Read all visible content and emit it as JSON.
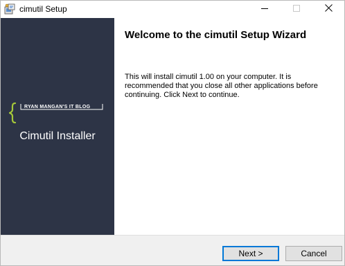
{
  "window": {
    "title": "cimutil Setup",
    "icon": "setup-installer-icon",
    "controls": {
      "minimize_icon": "minimize-icon",
      "maximize_icon": "maximize-icon",
      "close_icon": "close-icon"
    }
  },
  "sidebar": {
    "logo_text": "RYAN MANGAN'S IT BLOG",
    "logo_icon": "brace-icon",
    "installer_label": "Cimutil Installer",
    "background_color": "#2d3446",
    "accent_color": "#a6c93a"
  },
  "content": {
    "heading": "Welcome to the cimutil Setup Wizard",
    "body": "This will install cimutil 1.00 on your computer. It is recommended that you close all other applications before continuing. Click Next to continue."
  },
  "footer": {
    "next_label": "Next >",
    "cancel_label": "Cancel",
    "default_button_color": "#0078d7"
  }
}
